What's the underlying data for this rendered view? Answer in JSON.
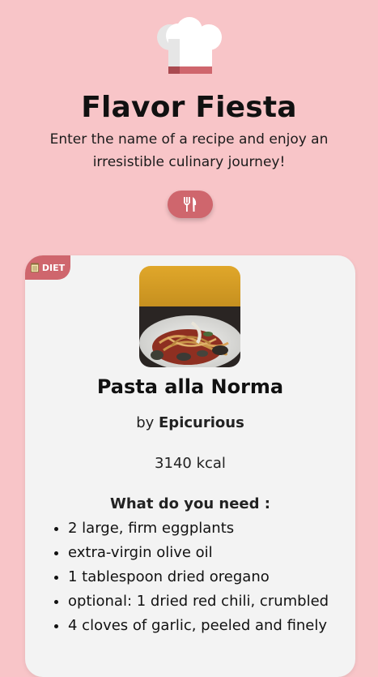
{
  "header": {
    "title": "Flavor Fiesta",
    "subtitle": "Enter the name of a recipe and enjoy an irresistible culinary journey!",
    "search_icon": "fork-knife-icon",
    "logo_icon": "chef-hat-icon"
  },
  "colors": {
    "background": "#f8c5c8",
    "accent": "#cf666d",
    "card": "#f3f3f3"
  },
  "recipe": {
    "badge_icon": "notepad-icon",
    "badge_label": "DIET",
    "image_alt": "pasta-photo",
    "name": "Pasta alla Norma",
    "by_label": "by",
    "author": "Epicurious",
    "calories": "3140 kcal",
    "ingredients_heading": "What do you need :",
    "ingredients": [
      "2 large, firm eggplants",
      "extra-virgin olive oil",
      "1 tablespoon dried oregano",
      "optional: 1 dried red chili, crumbled",
      "4 cloves of garlic, peeled and finely"
    ]
  }
}
